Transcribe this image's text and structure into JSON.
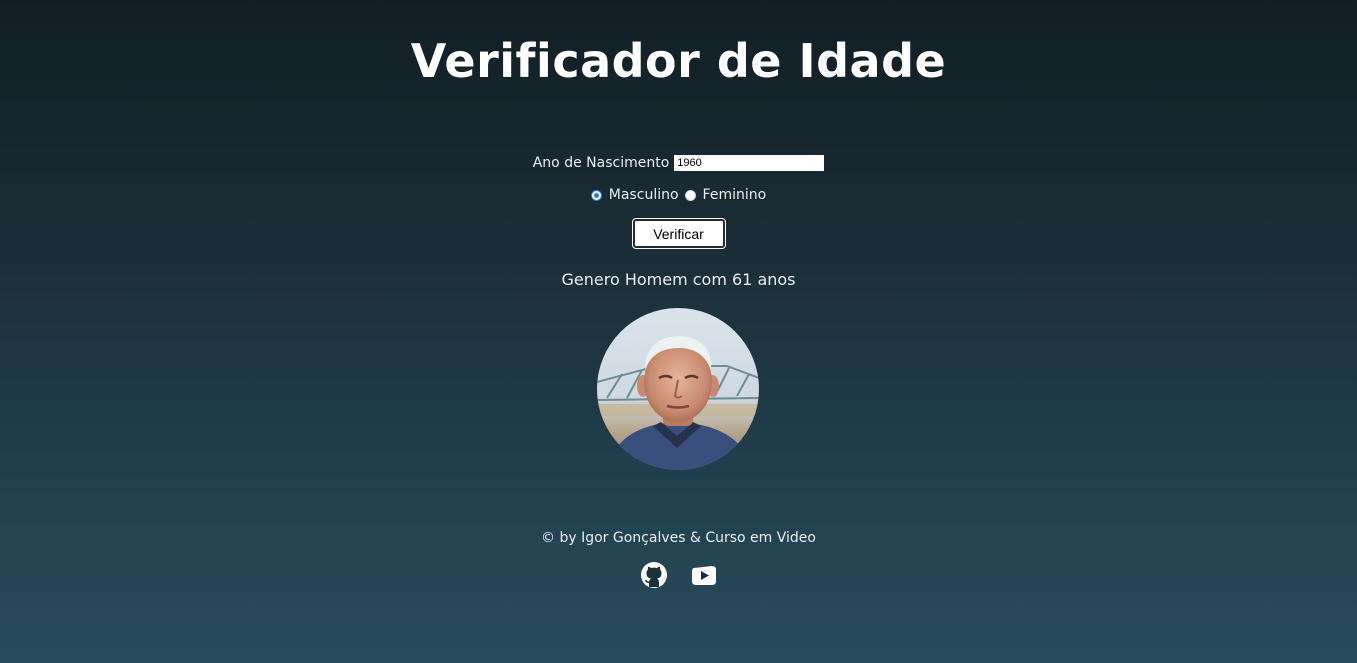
{
  "header": {
    "title": "Verificador de Idade"
  },
  "form": {
    "year_label": "Ano de Nascimento",
    "year_value": "1960",
    "sex_options": [
      {
        "label": "Masculino",
        "checked": true
      },
      {
        "label": "Feminino",
        "checked": false
      }
    ],
    "verify_label": "Verificar"
  },
  "result": {
    "text": "Genero Homem com 61 anos",
    "photo_icon": "elderly-man-photo"
  },
  "footer": {
    "credit": "© by Igor Gonçalves & Curso em Video",
    "links": [
      {
        "icon": "github-icon"
      },
      {
        "icon": "youtube-icon"
      }
    ]
  },
  "colors": {
    "background_top": "#111f25",
    "background_bottom": "#284b5c",
    "text": "#ffffff",
    "radio_accent": "#1f7ee8"
  }
}
